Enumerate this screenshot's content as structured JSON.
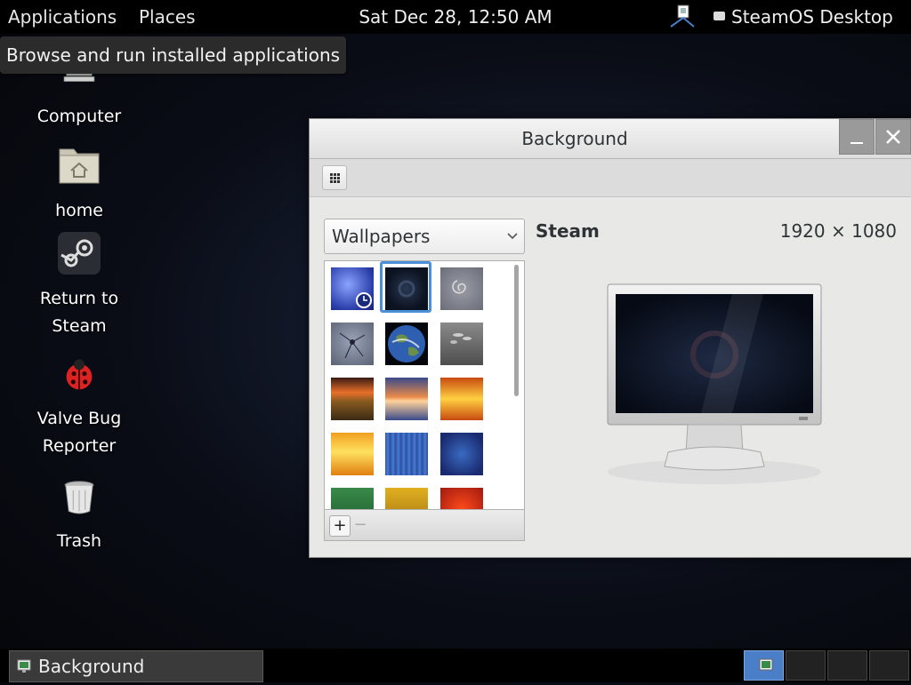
{
  "top_panel": {
    "applications_label": "Applications",
    "places_label": "Places",
    "clock": "Sat Dec 28, 12:50 AM",
    "desktop_switch_label": "SteamOS Desktop"
  },
  "tooltip": {
    "text": "Browse and run installed applications"
  },
  "desktop_icons": [
    {
      "label": "Computer",
      "icon": "computer-icon"
    },
    {
      "label": "home",
      "icon": "folder-home-icon"
    },
    {
      "label_lines": [
        "Return to",
        "Steam"
      ],
      "icon": "steam-icon"
    },
    {
      "label_lines": [
        "Valve Bug",
        "Reporter"
      ],
      "icon": "ladybug-icon"
    },
    {
      "label": "Trash",
      "icon": "trash-icon"
    }
  ],
  "window": {
    "title": "Background",
    "select_value": "Wallpapers",
    "preview_name": "Steam",
    "preview_resolution": "1920 × 1080",
    "add_label": "+",
    "remove_label": "−",
    "selected_index": 1,
    "thumbnails": [
      "blue-clock-wallpaper",
      "steam-dark-wallpaper",
      "grey-swirl-wallpaper",
      "cracked-glass-wallpaper",
      "earth-wallpaper",
      "grey-droplets-wallpaper",
      "sunset-field-wallpaper",
      "orange-bokeh-wallpaper",
      "orange-flare-wallpaper",
      "yellow-orange-wallpaper",
      "blue-stripes-wallpaper",
      "blue-texture-wallpaper",
      "green-wallpaper",
      "yellow-wallpaper",
      "red-flower-wallpaper"
    ]
  },
  "bottom_panel": {
    "taskbar_label": "Background",
    "workspaces": 4,
    "active_workspace": 0
  },
  "colors": {
    "accent": "#4a90d9",
    "panel": "#000000",
    "window_bg": "#e8e8e7"
  }
}
